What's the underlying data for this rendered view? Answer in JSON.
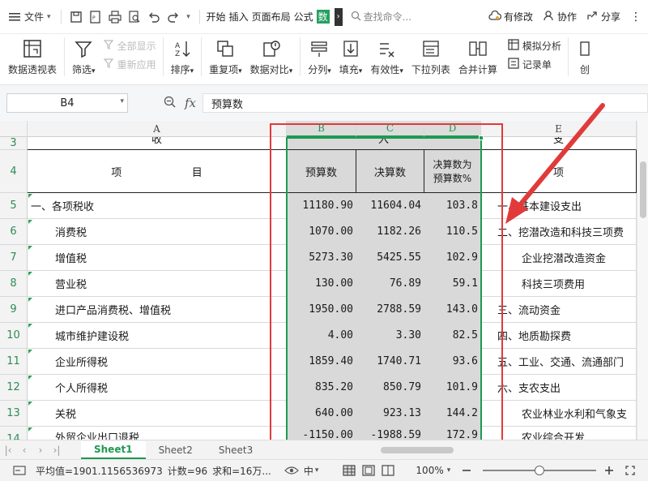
{
  "menubar": {
    "file_label": "文件",
    "tabs": [
      "开始",
      "插入",
      "页面布局",
      "公式",
      "数"
    ],
    "search_placeholder": "查找命令...",
    "modified_label": "有修改",
    "collab_label": "协作",
    "share_label": "分享"
  },
  "ribbon": {
    "pivot_label": "数据透视表",
    "filter_label": "筛选",
    "show_all_label": "全部显示",
    "reapply_label": "重新应用",
    "sort_label": "排序",
    "duplicates_label": "重复项",
    "compare_label": "数据对比",
    "split_label": "分列",
    "fill_label": "填充",
    "validity_label": "有效性",
    "dropdown_label": "下拉列表",
    "merge_calc_label": "合并计算",
    "simulate_label": "模拟分析",
    "record_label": "记录单",
    "create_label": "创"
  },
  "formulabar": {
    "cell_ref": "B4",
    "fx_label": "fx",
    "formula": "预算数"
  },
  "sheet": {
    "columns": [
      "A",
      "B",
      "C",
      "D",
      "E"
    ],
    "rows": [
      "3",
      "4",
      "5",
      "6",
      "7",
      "8",
      "9",
      "10",
      "11",
      "12",
      "13",
      "14"
    ],
    "row3": {
      "a": "收",
      "bcd": "入",
      "e": "支"
    },
    "header": {
      "a_left": "项",
      "a_right": "目",
      "b": "预算数",
      "c": "决算数",
      "d1": "决算数为",
      "d2": "预算数%",
      "e": "项"
    },
    "data": [
      {
        "a": "一、各项税收",
        "b": "11180.90",
        "c": "11604.04",
        "d": "103.8",
        "e": "一、基本建设支出"
      },
      {
        "a": "消费税",
        "b": "1070.00",
        "c": "1182.26",
        "d": "110.5",
        "e": "二、挖潜改造和科技三项费"
      },
      {
        "a": "增值税",
        "b": "5273.30",
        "c": "5425.55",
        "d": "102.9",
        "e": "企业挖潜改造资金"
      },
      {
        "a": "营业税",
        "b": "130.00",
        "c": "76.89",
        "d": "59.1",
        "e": "科技三项费用"
      },
      {
        "a": "进口产品消费税、增值税",
        "b": "1950.00",
        "c": "2788.59",
        "d": "143.0",
        "e": "三、流动资金"
      },
      {
        "a": "城市维护建设税",
        "b": "4.00",
        "c": "3.30",
        "d": "82.5",
        "e": "四、地质勘探费"
      },
      {
        "a": "企业所得税",
        "b": "1859.40",
        "c": "1740.71",
        "d": "93.6",
        "e": "五、工业、交通、流通部门"
      },
      {
        "a": "个人所得税",
        "b": "835.20",
        "c": "850.79",
        "d": "101.9",
        "e": "六、支农支出"
      },
      {
        "a": "关税",
        "b": "640.00",
        "c": "923.13",
        "d": "144.2",
        "e": "农业林业水利和气象支"
      },
      {
        "a": "外贸企业出口退税",
        "b": "-1150.00",
        "c": "-1988.59",
        "d": "172.9",
        "e": "农业综合开发"
      }
    ]
  },
  "sheettabs": [
    "Sheet1",
    "Sheet2",
    "Sheet3"
  ],
  "statusbar": {
    "average": "平均值=1901.1156536973",
    "count": "计数=96",
    "sum": "求和=16万...",
    "input_mode": "中",
    "zoom": "100%",
    "zoom_level": 0.5
  },
  "colors": {
    "accent": "#1e9a50",
    "annotation": "#e03a3a",
    "selection_fill": "#d9d9d9"
  }
}
